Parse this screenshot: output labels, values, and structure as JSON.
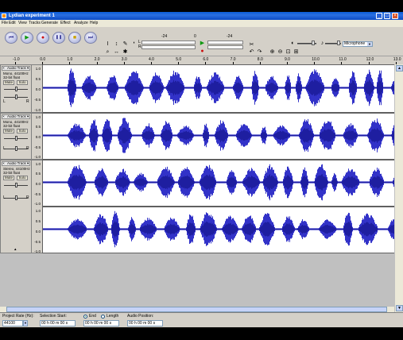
{
  "window": {
    "title": "Lydian experiment 1",
    "controls": {
      "minimize": "_",
      "maximize": "□",
      "close": "×"
    }
  },
  "menu": [
    "File",
    "Edit",
    "View",
    "Tracks",
    "Generate",
    "Effect",
    "Analyze",
    "Help"
  ],
  "toolbar": {
    "transport": [
      {
        "name": "skip-to-start-button",
        "icon": "skip-start-icon",
        "glyph": "⏮"
      },
      {
        "name": "play-button",
        "icon": "play-icon",
        "glyph": "▶"
      },
      {
        "name": "record-button",
        "icon": "record-icon",
        "glyph": "●"
      },
      {
        "name": "pause-button",
        "icon": "pause-icon",
        "glyph": "❚❚"
      },
      {
        "name": "stop-button",
        "icon": "stop-icon",
        "glyph": "■"
      },
      {
        "name": "skip-to-end-button",
        "icon": "skip-end-icon",
        "glyph": "⏭"
      }
    ],
    "meter_labels": {
      "left": "L",
      "right": "R"
    },
    "meter_ticks": [
      "-24",
      "0"
    ],
    "input_device": "Microphone"
  },
  "ruler": {
    "ticks": [
      "-1.0",
      "0.0",
      "1.0",
      "2.0",
      "3.0",
      "4.0",
      "5.0",
      "6.0",
      "7.0",
      "8.0",
      "9.0",
      "10.0",
      "11.0",
      "12.0",
      "13.0"
    ]
  },
  "tracks": [
    {
      "name": "Audio Track",
      "channel": "Mono, 44100Hz",
      "format": "32-bit float",
      "mute_label": "Mute",
      "solo_label": "Solo",
      "scale": [
        "1.0",
        "0.5",
        "0.0",
        "-0.5",
        "-1.0"
      ]
    },
    {
      "name": "Audio Track",
      "channel": "Mono, 44100Hz",
      "format": "32-bit float",
      "mute_label": "Mute",
      "solo_label": "Solo",
      "scale": [
        "1.0",
        "0.5",
        "0.0",
        "-0.5",
        "-1.0"
      ]
    },
    {
      "name": "Audio Track",
      "channel": "Stereo, 44100Hz",
      "format": "32-bit float",
      "mute_label": "Mute",
      "solo_label": "Solo",
      "scale": [
        "1.0",
        "0.5",
        "0.0",
        "-0.5",
        "-1.0"
      ],
      "scale2": [
        "1.0",
        "0.5",
        "0.0",
        "-0.5",
        "-1.0"
      ]
    }
  ],
  "bottom": {
    "project_rate_label": "Project Rate (Hz):",
    "project_rate_value": "44100",
    "selection_start_label": "Selection Start:",
    "selection_start_value": "00 h 00 m 00 s",
    "end_label": "End",
    "length_label": "Length",
    "end_value": "00 h 00 m 00 s",
    "audio_position_label": "Audio Position:",
    "audio_position_value": "00 h 00 m 00 s"
  },
  "colors": {
    "waveform": "#3232c8",
    "waveform_dark": "#1e1ea0",
    "background": "#d4d0c8"
  }
}
